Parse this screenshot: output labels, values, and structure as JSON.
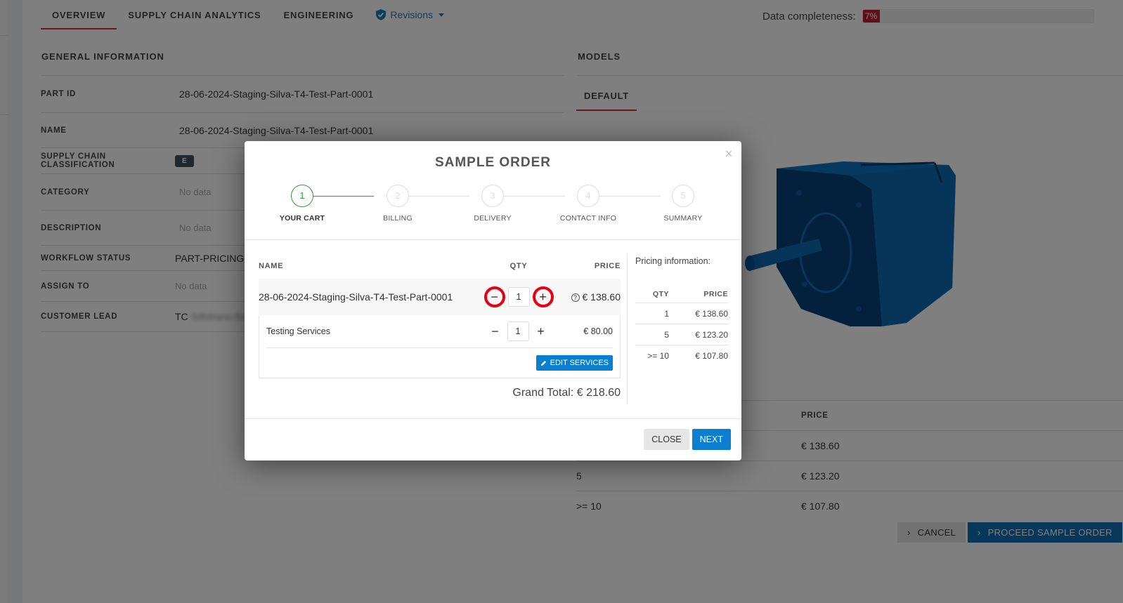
{
  "tabs": [
    {
      "label": "OVERVIEW",
      "active": true
    },
    {
      "label": "SUPPLY CHAIN ANALYTICS",
      "active": false
    },
    {
      "label": "ENGINEERING",
      "active": false
    },
    {
      "label": "Revisions",
      "icon": "shield-check-icon",
      "dropdown": true
    }
  ],
  "completeness": {
    "label": "Data completeness:",
    "value_percent": 7,
    "text": "7%",
    "color": "#c21f2d"
  },
  "general": {
    "title": "GENERAL INFORMATION",
    "rows": [
      {
        "label": "PART ID",
        "value": "28-06-2024-Staging-Silva-T4-Test-Part-0001"
      },
      {
        "label": "NAME",
        "value": "28-06-2024-Staging-Silva-T4-Test-Part-0001"
      },
      {
        "label": "SUPPLY CHAIN CLASSIFICATION",
        "badge": "E"
      },
      {
        "label": "CATEGORY",
        "value": "No data",
        "muted": true
      },
      {
        "label": "DESCRIPTION",
        "value": "No data",
        "muted": true
      },
      {
        "label": "WORKFLOW STATUS",
        "value": "PART-PRICING-I"
      },
      {
        "label": "ASSIGN TO",
        "value": "No data",
        "muted": true
      },
      {
        "label": "CUSTOMER LEAD",
        "value": "TC",
        "blurred": "Sithihanu Be"
      }
    ]
  },
  "models": {
    "title": "MODELS",
    "tab": "DEFAULT",
    "model_color": "#0a5f9e"
  },
  "bg_pricing": {
    "header_price": "PRICE",
    "rows": [
      {
        "qty": "",
        "price": "€ 138.60"
      },
      {
        "qty": "5",
        "price": "€ 123.20"
      },
      {
        "qty": ">= 10",
        "price": "€ 107.80"
      }
    ]
  },
  "bg_actions": {
    "cancel": "CANCEL",
    "proceed": "PROCEED SAMPLE ORDER"
  },
  "modal": {
    "title": "SAMPLE ORDER",
    "close_icon": "×",
    "steps": [
      {
        "num": "1",
        "label": "YOUR CART",
        "active": true
      },
      {
        "num": "2",
        "label": "BILLING"
      },
      {
        "num": "3",
        "label": "DELIVERY"
      },
      {
        "num": "4",
        "label": "CONTACT INFO"
      },
      {
        "num": "5",
        "label": "SUMMARY"
      }
    ],
    "cart": {
      "headers": {
        "name": "NAME",
        "qty": "QTY",
        "price": "PRICE"
      },
      "part": {
        "name": "28-06-2024-Staging-Silva-T4-Test-Part-0001",
        "qty": "1",
        "price": "€ 138.60",
        "minus": "−",
        "plus": "+",
        "help": "?"
      },
      "service": {
        "name": "Testing Services",
        "qty": "1",
        "price": "€ 80.00",
        "minus": "−",
        "plus": "+"
      },
      "edit_services": "EDIT SERVICES",
      "grand_total": "Grand Total: € 218.60"
    },
    "pricing": {
      "title": "Pricing information:",
      "headers": {
        "qty": "QTY",
        "price": "PRICE"
      },
      "rows": [
        {
          "qty": "1",
          "price": "€ 138.60"
        },
        {
          "qty": "5",
          "price": "€ 123.20"
        },
        {
          "qty": ">= 10",
          "price": "€ 107.80"
        }
      ]
    },
    "footer": {
      "close": "CLOSE",
      "next": "NEXT"
    }
  }
}
